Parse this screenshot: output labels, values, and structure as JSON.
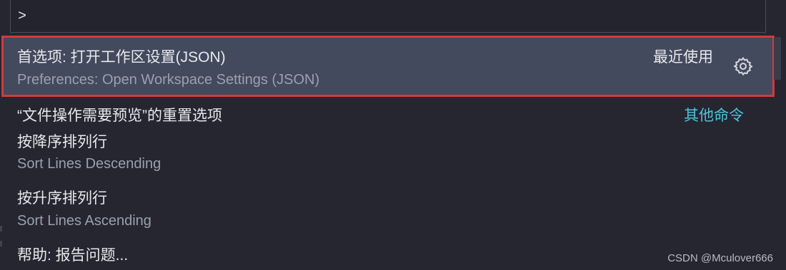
{
  "input": {
    "value": ">"
  },
  "commands": [
    {
      "label": "首选项: 打开工作区设置(JSON)",
      "detail": "Preferences: Open Workspace Settings (JSON)",
      "badge": "最近使用",
      "selected": true
    },
    {
      "label": "“文件操作需要预览”的重置选项",
      "detail": "",
      "badge": "其他命令",
      "selected": false
    },
    {
      "label": "按降序排列行",
      "detail": "Sort Lines Descending",
      "badge": "",
      "selected": false
    },
    {
      "label": "按升序排列行",
      "detail": "Sort Lines Ascending",
      "badge": "",
      "selected": false
    },
    {
      "label": "帮助: 报告问题...",
      "detail": "",
      "badge": "",
      "selected": false
    }
  ],
  "icons": {
    "configure": "gear-icon"
  },
  "colors": {
    "background": "#252630",
    "selected_row": "#434a5e",
    "highlight_border": "#d43a3a",
    "badge_recent": "#e8e9ec",
    "badge_other": "#4fc3dc",
    "detail_text": "#9aa0ad"
  },
  "watermark": "CSDN @Mculover666"
}
